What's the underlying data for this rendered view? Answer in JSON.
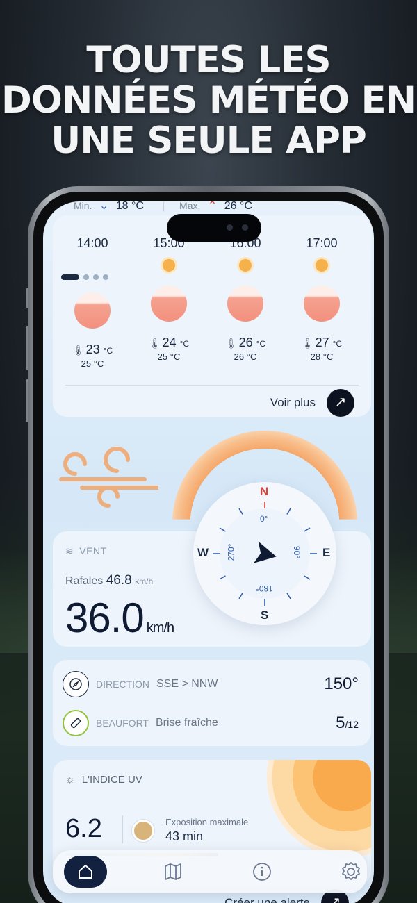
{
  "headline": [
    "TOUTES LES",
    "DONNÉES MÉTÉO EN",
    "UNE SEULE APP"
  ],
  "colors": {
    "accent": "#11213f",
    "sun": "#f4b14c",
    "wind_arc": "#f5a76a",
    "beaufort_ring": "#93c33f",
    "direction_blue": "#2f5fb0"
  },
  "minmax": {
    "min_label": "Min.",
    "min_value": "18 °C",
    "max_label": "Max.",
    "max_value": "26 °C"
  },
  "hourly": {
    "hours": [
      {
        "time": "14:00",
        "temp": "23",
        "feels": "25"
      },
      {
        "time": "15:00",
        "temp": "24",
        "feels": "25"
      },
      {
        "time": "16:00",
        "temp": "26",
        "feels": "26"
      },
      {
        "time": "17:00",
        "temp": "27",
        "feels": "28"
      }
    ],
    "unit": "°C",
    "more_label": "Voir plus",
    "pager_active_index": 0,
    "pager_count": 4
  },
  "wind": {
    "label": "VENT",
    "gust_label": "Rafales",
    "gust_value": "46.8",
    "gust_unit": "km/h",
    "speed": "36.0",
    "speed_unit": "km/h",
    "compass": {
      "n": "N",
      "e": "E",
      "s": "S",
      "w": "W",
      "deg0": "0°",
      "deg90": "90°",
      "deg180": "180°",
      "deg270": "270°"
    }
  },
  "direction": {
    "label": "DIRECTION",
    "sub": "SSE > NNW",
    "value": "150°"
  },
  "beaufort": {
    "label": "BEAUFORT",
    "sub": "Brise fraîche",
    "value": "5",
    "max": "/12"
  },
  "uv": {
    "title": "L'INDICE UV",
    "value": "6.2",
    "exposure_label": "Exposition maximale",
    "exposure_value": "43 min"
  },
  "alert": {
    "label": "Créer une alerte"
  },
  "tabs": [
    {
      "icon": "home-icon",
      "active": true
    },
    {
      "icon": "map-icon",
      "active": false
    },
    {
      "icon": "info-icon",
      "active": false
    },
    {
      "icon": "gear-icon",
      "active": false
    }
  ]
}
